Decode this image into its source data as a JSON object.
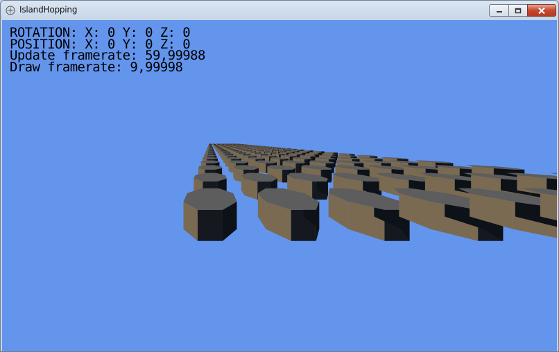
{
  "window": {
    "title": "IslandHopping",
    "icon": "app-icon",
    "controls": {
      "minimize_icon": "minimize-icon",
      "maximize_icon": "maximize-icon",
      "close_icon": "close-icon"
    }
  },
  "hud": {
    "rotation": "ROTATION: X: 0 Y: 0 Z: 0",
    "position": "POSITION: X: 0 Y: 0 Z: 0",
    "update_framerate": "Update framerate: 59,99988",
    "draw_framerate": "Draw framerate: 9,99998"
  },
  "scene": {
    "background_color": "#6495ed",
    "pillar_top_color": "#5d5d5d",
    "pillar_side_light": "#7a6a52",
    "pillar_side_dark": "#0d1118",
    "object_type": "octagonal-pillar-grid"
  }
}
